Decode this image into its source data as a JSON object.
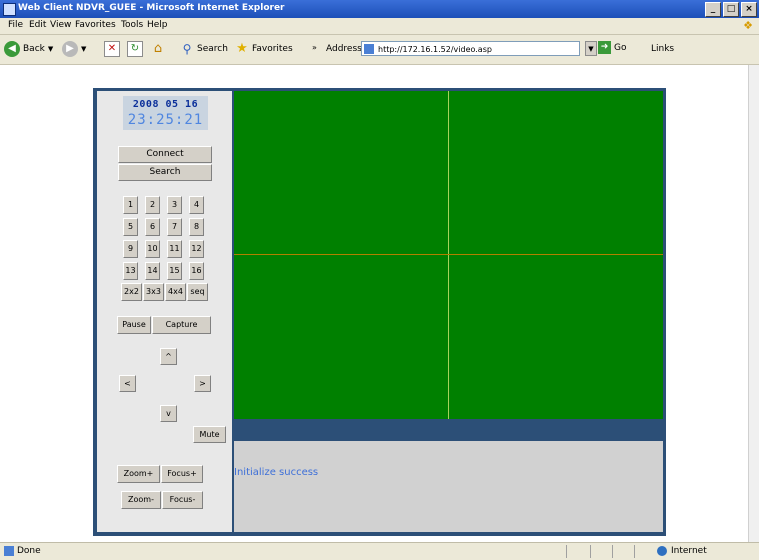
{
  "window": {
    "title": "Web Client NDVR_GUEE - Microsoft Internet Explorer",
    "min": "_",
    "max": "□",
    "close": "×"
  },
  "menu": [
    "File",
    "Edit",
    "View",
    "Favorites",
    "Tools",
    "Help"
  ],
  "toolbar": {
    "back": "Back",
    "search": "Search",
    "favorites": "Favorites",
    "address_label": "Address",
    "address_value": "http://172.16.1.52/video.asp",
    "go": "Go",
    "links": "Links"
  },
  "clock": {
    "date": "2008 05 16",
    "time": "23:25:21"
  },
  "panel": {
    "connect": "Connect",
    "search": "Search",
    "channels": [
      "1",
      "2",
      "3",
      "4",
      "5",
      "6",
      "7",
      "8",
      "9",
      "10",
      "11",
      "12",
      "13",
      "14",
      "15",
      "16"
    ],
    "layouts": [
      "2x2",
      "3x3",
      "4x4",
      "seq"
    ],
    "pause": "Pause",
    "capture": "Capture",
    "ptz": {
      "up": "^",
      "left": "<",
      "right": ">",
      "down": "v"
    },
    "mute": "Mute",
    "zoom_in": "Zoom+",
    "focus_in": "Focus+",
    "zoom_out": "Zoom-",
    "focus_out": "Focus-"
  },
  "status_message": "Initialize success",
  "statusbar": {
    "done": "Done",
    "zone": "Internet"
  },
  "colors": {
    "video_bg": "#008000",
    "frame": "#2c4f77",
    "date": "#0b2f9a",
    "time": "#4f86e0",
    "status_text": "#3d6fd8"
  }
}
